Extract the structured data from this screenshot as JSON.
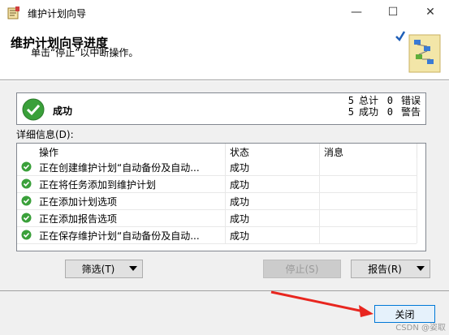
{
  "window": {
    "title": "维护计划向导",
    "minimize_label": "—",
    "maximize_label": "☐",
    "close_label": "✕"
  },
  "header": {
    "title": "维护计划向导进度",
    "subtitle": "单击“停止”以中断操作。"
  },
  "status": {
    "label": "成功",
    "total_count": "5",
    "total_label": "总计",
    "error_count": "0",
    "error_label": "错误",
    "success_count": "5",
    "success_label": "成功",
    "warning_count": "0",
    "warning_label": "警告"
  },
  "details": {
    "label": "详细信息(D):",
    "columns": [
      "操作",
      "状态",
      "消息"
    ],
    "rows": [
      {
        "operation": "正在创建维护计划“自动备份及自动...",
        "status": "成功",
        "message": ""
      },
      {
        "operation": "正在将任务添加到维护计划",
        "status": "成功",
        "message": ""
      },
      {
        "operation": "正在添加计划选项",
        "status": "成功",
        "message": ""
      },
      {
        "operation": "正在添加报告选项",
        "status": "成功",
        "message": ""
      },
      {
        "operation": "正在保存维护计划“自动备份及自动...",
        "status": "成功",
        "message": ""
      }
    ]
  },
  "buttons": {
    "filter": "筛选(T)",
    "stop": "停止(S)",
    "report": "报告(R)",
    "close": "关闭"
  },
  "watermark": "CSDN @姿取",
  "colors": {
    "success_green": "#3aa03a",
    "annotation_red": "#e8261f",
    "focus_blue": "#0078d7"
  }
}
